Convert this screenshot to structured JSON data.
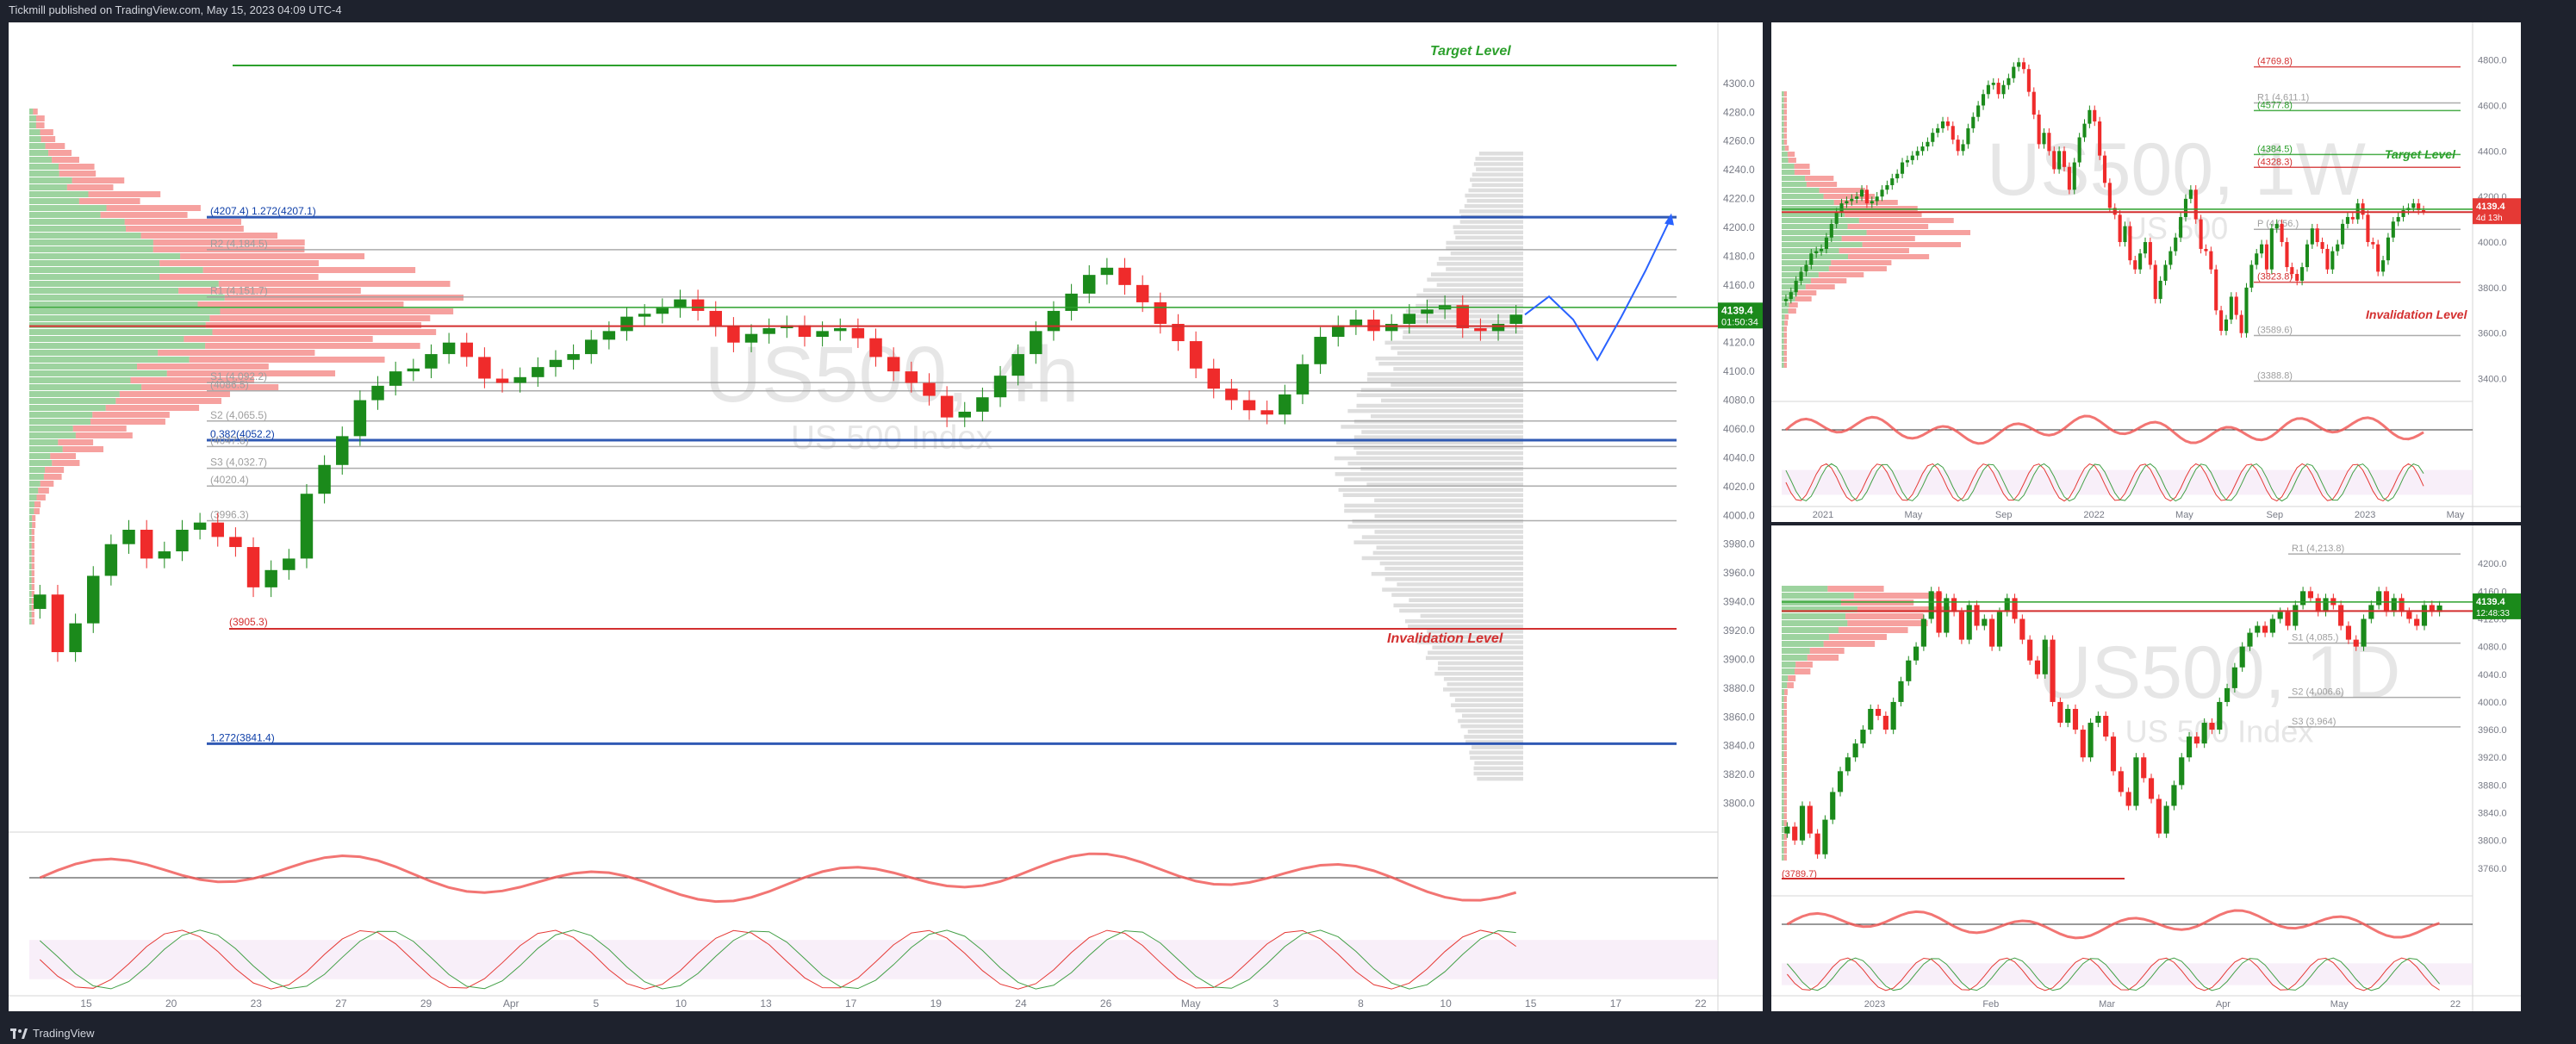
{
  "header": {
    "publish_text": "Tickmill published on TradingView.com, May 15, 2023 04:09 UTC-4"
  },
  "footer": {
    "brand": "TradingView"
  },
  "colors": {
    "up": "#1b8a1b",
    "down": "#ef2b2b",
    "green_line": "#2ca02c",
    "red_line": "#d32f2f",
    "blue": "#0d3ea8",
    "magenta": "#d35ad3",
    "orange": "#ff9800",
    "arrow": "#2962ff"
  },
  "chart_data": [
    {
      "type": "line",
      "panel": "4h",
      "watermark": "US500, 4h",
      "subtitle": "US 500 Index",
      "ylim": [
        3780,
        4340
      ],
      "price_ticks": [
        "4300.0",
        "4280.0",
        "4260.0",
        "4240.0",
        "4220.0",
        "4200.0",
        "4180.0",
        "4160.0",
        "4140.0",
        "4120.0",
        "4100.0",
        "4080.0",
        "4060.0",
        "4040.0",
        "4020.0",
        "4000.0",
        "3980.0",
        "3960.0",
        "3940.0",
        "3920.0",
        "3900.0",
        "3880.0",
        "3860.0",
        "3840.0",
        "3820.0",
        "3800.0"
      ],
      "time_ticks": [
        "15",
        "20",
        "23",
        "27",
        "29",
        "Apr",
        "5",
        "10",
        "13",
        "17",
        "19",
        "24",
        "26",
        "May",
        "3",
        "8",
        "10",
        "15",
        "17",
        "22"
      ],
      "last_price": "4139.4",
      "countdown": "01:50:34",
      "annotations": {
        "target": "Target Level",
        "invalidation": "Invalidation Level",
        "invalidation_price": "(3905.3)"
      },
      "levels": [
        {
          "label": "(4207.4) 1.272(4207.1)",
          "price": 4207.1,
          "color": "#0d3ea8"
        },
        {
          "label": "R2 (4,184.5)",
          "price": 4184.5,
          "color": "#9e9e9e"
        },
        {
          "label": "R1 (4,151.7)",
          "price": 4151.7,
          "color": "#9e9e9e"
        },
        {
          "label": "(4086.5)",
          "price": 4086.5,
          "color": "#9e9e9e"
        },
        {
          "label": "S1 (4,092.2)",
          "price": 4092.2,
          "color": "#9e9e9e"
        },
        {
          "label": "S2 (4,065.5)",
          "price": 4065.5,
          "color": "#9e9e9e"
        },
        {
          "label": "0.382(4052.2)",
          "price": 4052.2,
          "color": "#0d3ea8"
        },
        {
          "label": "(4047.8)",
          "price": 4047.8,
          "color": "#9e9e9e"
        },
        {
          "label": "S3 (4,032.7)",
          "price": 4032.7,
          "color": "#9e9e9e"
        },
        {
          "label": "(4020.4)",
          "price": 4020.4,
          "color": "#9e9e9e"
        },
        {
          "label": "(3996.3)",
          "price": 3996.3,
          "color": "#9e9e9e"
        },
        {
          "label": "1.272(3841.4)",
          "price": 3841.4,
          "color": "#0d3ea8"
        }
      ],
      "close": [
        3945,
        3905,
        3925,
        3958,
        3980,
        3990,
        3970,
        3975,
        3990,
        3995,
        3985,
        3978,
        3950,
        3962,
        3970,
        4015,
        4035,
        4055,
        4080,
        4090,
        4100,
        4102,
        4112,
        4120,
        4110,
        4095,
        4092,
        4096,
        4103,
        4108,
        4112,
        4122,
        4128,
        4138,
        4140,
        4144,
        4150,
        4142,
        4131,
        4120,
        4126,
        4130,
        4132,
        4124,
        4128,
        4130,
        4123,
        4110,
        4100,
        4092,
        4083,
        4068,
        4072,
        4082,
        4097,
        4112,
        4128,
        4142,
        4154,
        4167,
        4172,
        4160,
        4148,
        4133,
        4121,
        4102,
        4088,
        4080,
        4073,
        4070,
        4084,
        4105,
        4124,
        4132,
        4136,
        4128,
        4133,
        4140,
        4143,
        4146,
        4130,
        4128,
        4133,
        4139.4
      ],
      "projection": [
        [
          0,
          4139.4
        ],
        [
          1,
          4152
        ],
        [
          2,
          4136
        ],
        [
          3,
          4108
        ],
        [
          4,
          4138
        ],
        [
          5,
          4170
        ],
        [
          6,
          4205
        ]
      ]
    },
    {
      "type": "line",
      "panel": "1W",
      "watermark": "US500, 1W",
      "subtitle": "US 500",
      "ylim": [
        3300,
        4950
      ],
      "price_ticks": [
        "4800.0",
        "4600.0",
        "4400.0",
        "4200.0",
        "4000.0",
        "3800.0",
        "3600.0",
        "3400.0"
      ],
      "time_ticks": [
        "2021",
        "May",
        "Sep",
        "2022",
        "May",
        "Sep",
        "2023",
        "May"
      ],
      "last_price": "4139.4",
      "countdown": "4d 13h",
      "annotations": {
        "target": "Target Level",
        "invalidation": "Invalidation Level"
      },
      "levels": [
        {
          "label": "(4769.8)",
          "price": 4769.8,
          "color": "#d32f2f"
        },
        {
          "label": "R1 (4,611.1)",
          "price": 4611.1,
          "color": "#9e9e9e"
        },
        {
          "label": "(4577.8)",
          "price": 4577.8,
          "color": "#2ca02c"
        },
        {
          "label": "(4384.5)",
          "price": 4384.5,
          "color": "#2ca02c"
        },
        {
          "label": "(4328.3)",
          "price": 4328.3,
          "color": "#d32f2f"
        },
        {
          "label": "P (4,056.)",
          "price": 4056,
          "color": "#9e9e9e"
        },
        {
          "label": "(3823.8)",
          "price": 3823.8,
          "color": "#d32f2f"
        },
        {
          "label": "(3589.6)",
          "price": 3589.6,
          "color": "#9e9e9e"
        },
        {
          "label": "(3388.8)",
          "price": 3388.8,
          "color": "#9e9e9e"
        }
      ],
      "close": [
        3750,
        3780,
        3830,
        3870,
        3900,
        3950,
        3960,
        3970,
        4020,
        4080,
        4130,
        4170,
        4180,
        4190,
        4200,
        4230,
        4170,
        4180,
        4200,
        4230,
        4250,
        4280,
        4300,
        4350,
        4360,
        4380,
        4400,
        4420,
        4440,
        4480,
        4500,
        4530,
        4510,
        4450,
        4400,
        4430,
        4500,
        4550,
        4600,
        4650,
        4690,
        4700,
        4650,
        4690,
        4720,
        4770,
        4790,
        4760,
        4660,
        4560,
        4430,
        4480,
        4400,
        4320,
        4400,
        4330,
        4230,
        4350,
        4460,
        4520,
        4580,
        4530,
        4380,
        4260,
        4150,
        4120,
        4000,
        4070,
        3920,
        3880,
        3950,
        4000,
        3900,
        3750,
        3830,
        3900,
        3960,
        4020,
        4110,
        4190,
        4230,
        4100,
        3970,
        3960,
        3880,
        3700,
        3610,
        3660,
        3760,
        3680,
        3600,
        3800,
        3900,
        3950,
        3990,
        3880,
        4060,
        4080,
        4000,
        3890,
        3860,
        3830,
        3890,
        3990,
        4060,
        4000,
        3970,
        3880,
        3960,
        3990,
        4080,
        4110,
        4100,
        4170,
        4120,
        4000,
        3990,
        3870,
        3920,
        4020,
        4090,
        4110,
        4140,
        4150,
        4170,
        4140,
        4139.4
      ]
    },
    {
      "type": "line",
      "panel": "1D",
      "watermark": "US500, 1D",
      "subtitle": "US 500 Index",
      "ylim": [
        3720,
        4250
      ],
      "price_ticks": [
        "4200.0",
        "4160.0",
        "4120.0",
        "4080.0",
        "4040.0",
        "4000.0",
        "3960.0",
        "3920.0",
        "3880.0",
        "3840.0",
        "3800.0",
        "3760.0"
      ],
      "time_ticks": [
        "2023",
        "Feb",
        "Mar",
        "Apr",
        "May",
        "22"
      ],
      "last_price": "4139.4",
      "countdown": "12:48:33",
      "annotations": {
        "invalidation_price": "(3789.7)"
      },
      "levels": [
        {
          "label": "R1 (4,213.8)",
          "price": 4213.8,
          "color": "#9e9e9e"
        },
        {
          "label": "S1 (4,085.)",
          "price": 4085,
          "color": "#9e9e9e"
        },
        {
          "label": "S2 (4,006.6)",
          "price": 4006.6,
          "color": "#9e9e9e"
        },
        {
          "label": "S3 (3,964)",
          "price": 3964,
          "color": "#9e9e9e"
        }
      ],
      "close": [
        3820,
        3800,
        3850,
        3810,
        3780,
        3830,
        3870,
        3900,
        3920,
        3940,
        3960,
        3990,
        3980,
        3960,
        4000,
        4030,
        4060,
        4080,
        4120,
        4160,
        4100,
        4150,
        4130,
        4090,
        4140,
        4110,
        4120,
        4080,
        4130,
        4150,
        4120,
        4090,
        4060,
        4040,
        4090,
        4000,
        3970,
        3990,
        3960,
        3920,
        3970,
        3980,
        3950,
        3900,
        3870,
        3850,
        3920,
        3890,
        3860,
        3810,
        3850,
        3880,
        3920,
        3950,
        3940,
        3970,
        3960,
        4000,
        4020,
        4050,
        4080,
        4100,
        4110,
        4100,
        4120,
        4130,
        4110,
        4140,
        4160,
        4150,
        4130,
        4150,
        4140,
        4110,
        4090,
        4080,
        4120,
        4140,
        4160,
        4130,
        4150,
        4130,
        4120,
        4110,
        4140,
        4130,
        4139.4
      ]
    }
  ]
}
